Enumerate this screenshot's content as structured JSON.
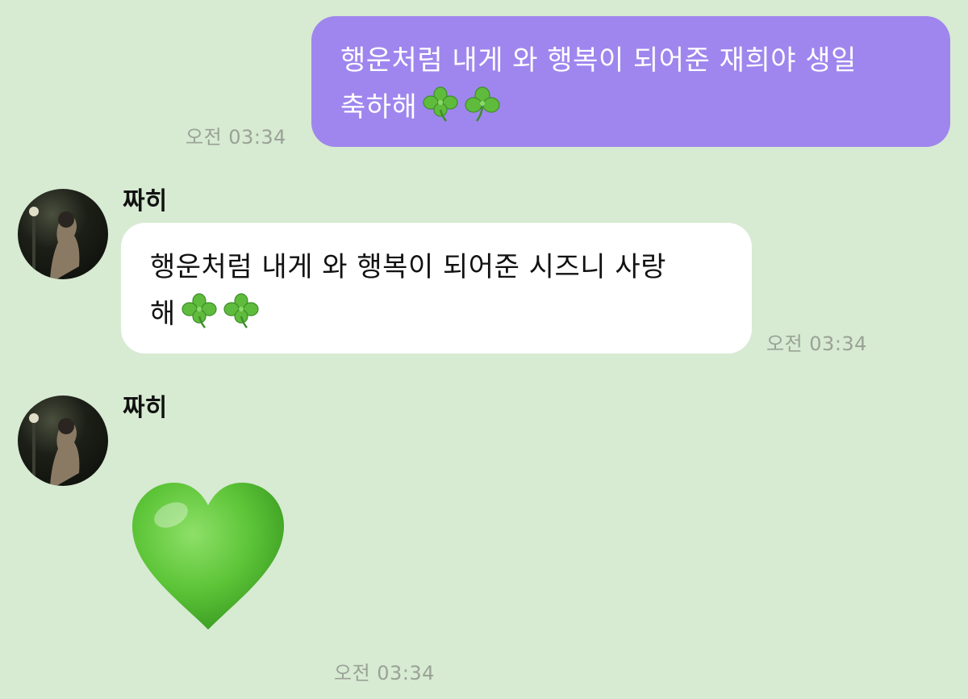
{
  "messages": [
    {
      "direction": "outgoing",
      "text_line1": "행운처럼 내게 와 행복이 되어준 재희야 생일",
      "text_line2": "축하해",
      "emoji": [
        "clover-icon",
        "shamrock-icon"
      ],
      "time": "오전 03:34"
    },
    {
      "direction": "incoming",
      "sender": "짜히",
      "text_line1": "행운처럼 내게 와 행복이 되어준 시즈니 사랑",
      "text_line2": "해",
      "emoji": [
        "clover-icon",
        "clover-icon"
      ],
      "time": "오전 03:34"
    },
    {
      "direction": "incoming",
      "sender": "짜히",
      "sticker": "green-heart-icon",
      "time": "오전 03:34"
    }
  ],
  "colors": {
    "background": "#d7ead2",
    "outgoing_bubble": "#9f86ee",
    "incoming_bubble": "#ffffff",
    "heart": "#5cc437"
  }
}
